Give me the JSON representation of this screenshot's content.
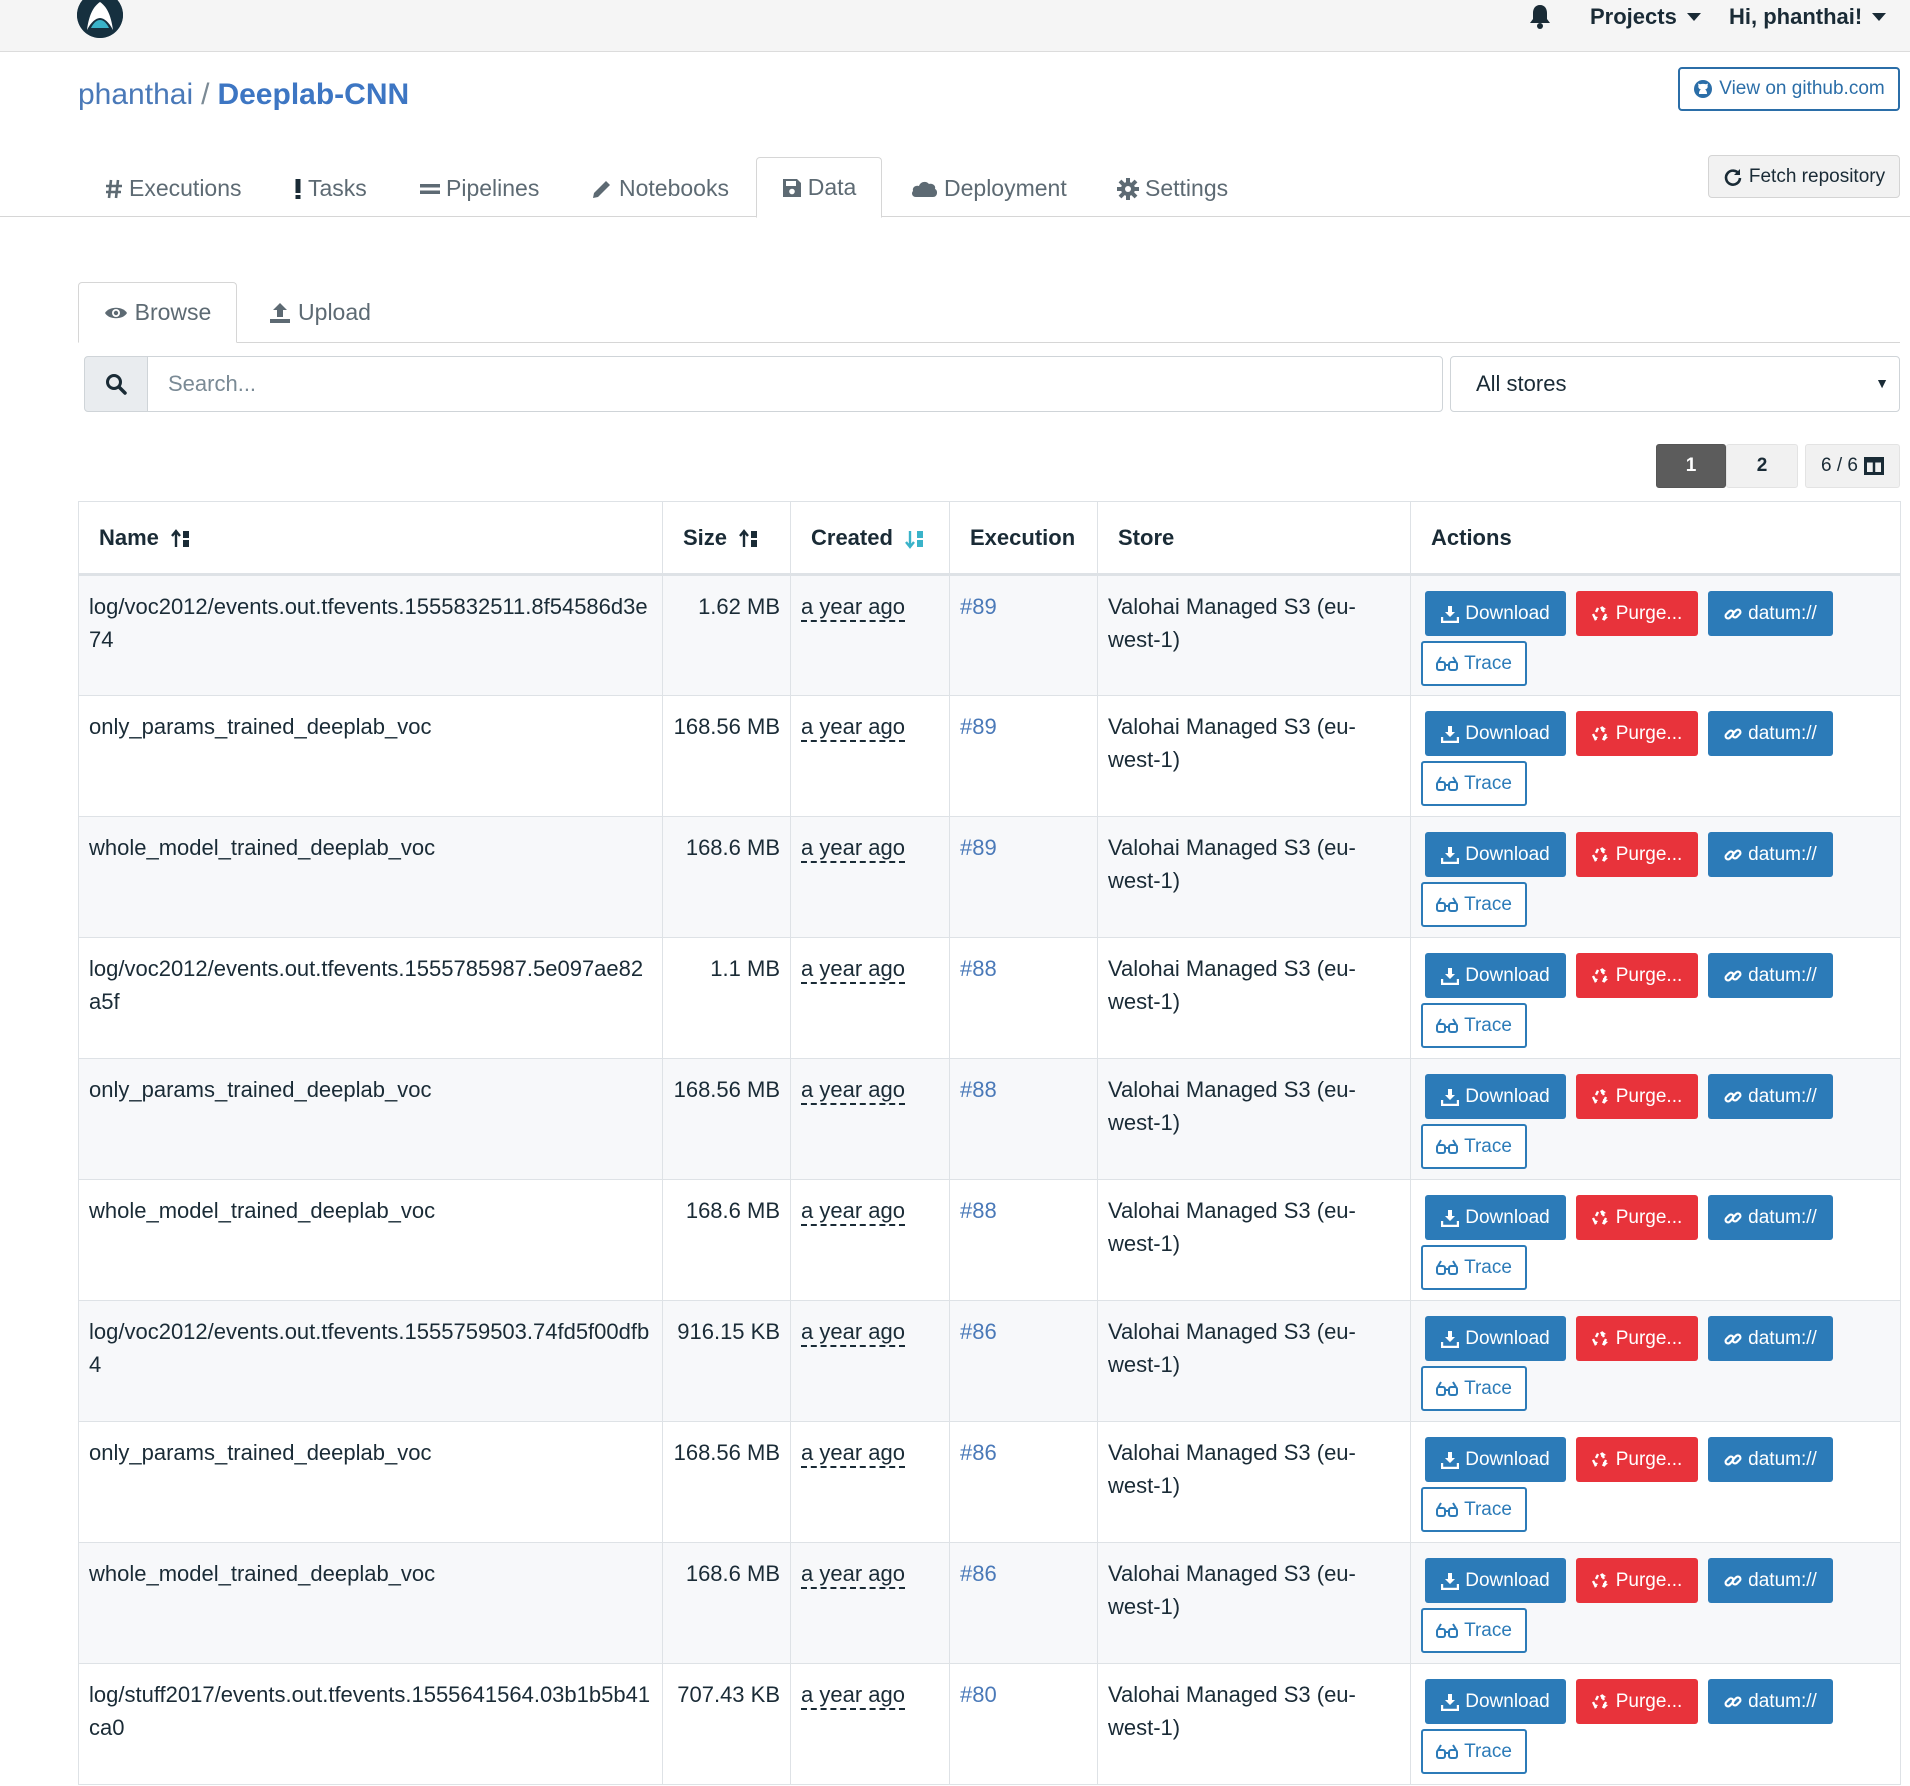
{
  "navbar": {
    "projects_label": "Projects",
    "user_label": "Hi, phanthai!"
  },
  "project": {
    "owner": "phanthai",
    "separator": "/",
    "name": "Deeplab-CNN",
    "github_button": "View on github.com",
    "fetch_button": "Fetch repository"
  },
  "tabs": [
    {
      "label": "Executions",
      "icon": "hash-icon"
    },
    {
      "label": "Tasks",
      "icon": "exclamation-icon"
    },
    {
      "label": "Pipelines",
      "icon": "equals-icon"
    },
    {
      "label": "Notebooks",
      "icon": "pencil-icon"
    },
    {
      "label": "Data",
      "icon": "save-icon",
      "active": true
    },
    {
      "label": "Deployment",
      "icon": "cloud-icon"
    },
    {
      "label": "Settings",
      "icon": "gear-icon"
    }
  ],
  "subtabs": [
    {
      "label": "Browse",
      "icon": "eye-icon",
      "active": true
    },
    {
      "label": "Upload",
      "icon": "upload-icon"
    }
  ],
  "search": {
    "placeholder": "Search...",
    "store_selected": "All stores"
  },
  "pagination": {
    "pages": [
      "1",
      "2"
    ],
    "current": "1",
    "columns": "6 / 6"
  },
  "table": {
    "headers": {
      "name": "Name",
      "size": "Size",
      "created": "Created",
      "execution": "Execution",
      "store": "Store",
      "actions": "Actions"
    },
    "action_labels": {
      "download": "Download",
      "purge": "Purge...",
      "datum": "datum://",
      "trace": "Trace"
    },
    "rows": [
      {
        "name": "log/voc2012/events.out.tfevents.1555832511.8f54586d3e74",
        "size": "1.62 MB",
        "created": "a year ago",
        "execution": "#89",
        "store": "Valohai Managed S3 (eu-west-1)"
      },
      {
        "name": "only_params_trained_deeplab_voc",
        "size": "168.56 MB",
        "created": "a year ago",
        "execution": "#89",
        "store": "Valohai Managed S3 (eu-west-1)"
      },
      {
        "name": "whole_model_trained_deeplab_voc",
        "size": "168.6 MB",
        "created": "a year ago",
        "execution": "#89",
        "store": "Valohai Managed S3 (eu-west-1)"
      },
      {
        "name": "log/voc2012/events.out.tfevents.1555785987.5e097ae82a5f",
        "size": "1.1 MB",
        "created": "a year ago",
        "execution": "#88",
        "store": "Valohai Managed S3 (eu-west-1)"
      },
      {
        "name": "only_params_trained_deeplab_voc",
        "size": "168.56 MB",
        "created": "a year ago",
        "execution": "#88",
        "store": "Valohai Managed S3 (eu-west-1)"
      },
      {
        "name": "whole_model_trained_deeplab_voc",
        "size": "168.6 MB",
        "created": "a year ago",
        "execution": "#88",
        "store": "Valohai Managed S3 (eu-west-1)"
      },
      {
        "name": "log/voc2012/events.out.tfevents.1555759503.74fd5f00dfb4",
        "size": "916.15 KB",
        "created": "a year ago",
        "execution": "#86",
        "store": "Valohai Managed S3 (eu-west-1)"
      },
      {
        "name": "only_params_trained_deeplab_voc",
        "size": "168.56 MB",
        "created": "a year ago",
        "execution": "#86",
        "store": "Valohai Managed S3 (eu-west-1)"
      },
      {
        "name": "whole_model_trained_deeplab_voc",
        "size": "168.6 MB",
        "created": "a year ago",
        "execution": "#86",
        "store": "Valohai Managed S3 (eu-west-1)"
      },
      {
        "name": "log/stuff2017/events.out.tfevents.1555641564.03b1b5b41ca0",
        "size": "707.43 KB",
        "created": "a year ago",
        "execution": "#80",
        "store": "Valohai Managed S3 (eu-west-1)"
      }
    ]
  },
  "colors": {
    "primary": "#2c7bb8",
    "danger": "#e8333b",
    "link": "#4a79b8",
    "sort_active": "#3ab3c9"
  }
}
